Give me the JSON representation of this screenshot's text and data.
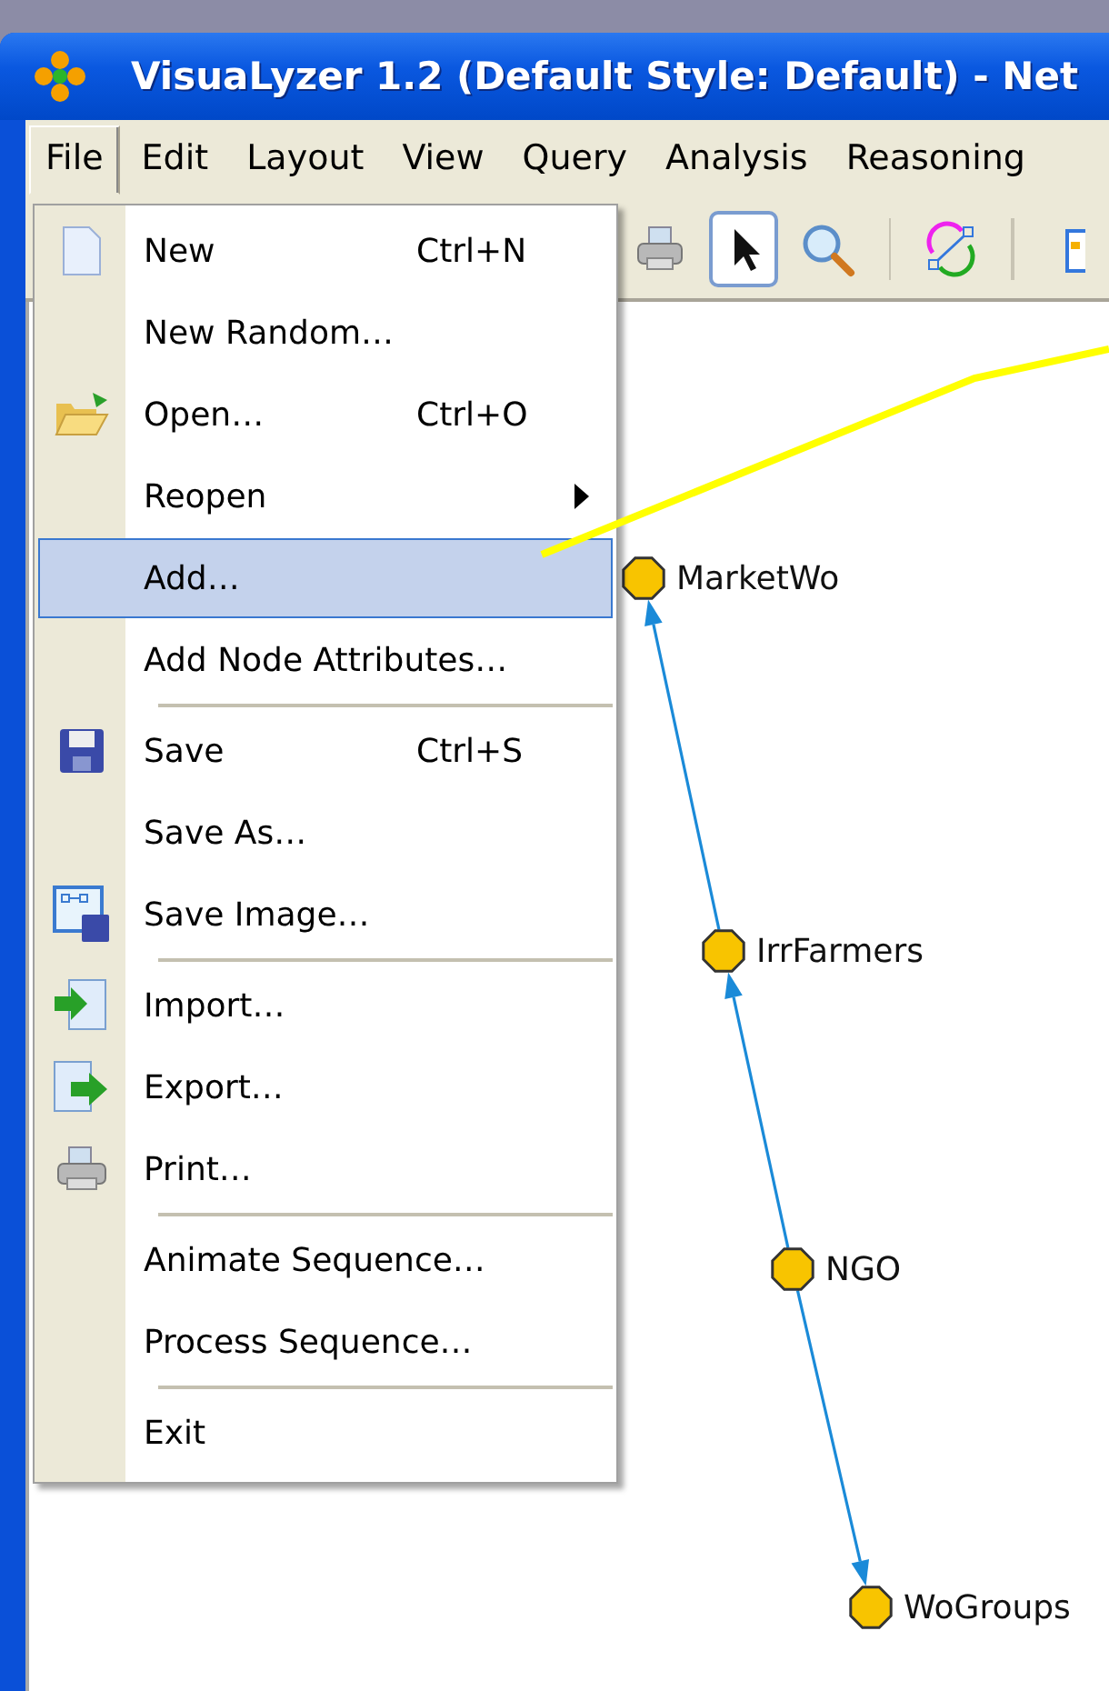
{
  "window": {
    "title": "VisuaLyzer 1.2 (Default Style: Default) - Net"
  },
  "menu_bar": [
    {
      "label": "File",
      "selected": true
    },
    {
      "label": "Edit",
      "selected": false
    },
    {
      "label": "Layout",
      "selected": false
    },
    {
      "label": "View",
      "selected": false
    },
    {
      "label": "Query",
      "selected": false
    },
    {
      "label": "Analysis",
      "selected": false
    },
    {
      "label": "Reasoning",
      "selected": false
    }
  ],
  "toolbar": [
    {
      "kind": "printer",
      "selected": false
    },
    {
      "kind": "pointer",
      "selected": true
    },
    {
      "kind": "zoom",
      "selected": false
    },
    {
      "kind": "separator"
    },
    {
      "kind": "cycle",
      "selected": false
    },
    {
      "kind": "separator"
    },
    {
      "kind": "layout",
      "selected": false
    }
  ],
  "file_menu": [
    {
      "kind": "item",
      "label": "New",
      "shortcut": "Ctrl+N",
      "submenu": false,
      "selected": false
    },
    {
      "kind": "item",
      "label": "New Random…",
      "submenu": false,
      "selected": false
    },
    {
      "kind": "item",
      "label": "Open…",
      "shortcut": "Ctrl+O",
      "submenu": false,
      "selected": false
    },
    {
      "kind": "item",
      "label": "Reopen",
      "submenu": true,
      "selected": false
    },
    {
      "kind": "item",
      "label": "Add…",
      "submenu": false,
      "selected": true
    },
    {
      "kind": "item",
      "label": "Add Node Attributes…",
      "submenu": false,
      "selected": false
    },
    {
      "kind": "separator"
    },
    {
      "kind": "item",
      "label": "Save",
      "shortcut": "Ctrl+S",
      "submenu": false,
      "selected": false
    },
    {
      "kind": "item",
      "label": "Save As…",
      "submenu": false,
      "selected": false
    },
    {
      "kind": "item",
      "label": "Save Image…",
      "submenu": false,
      "selected": false
    },
    {
      "kind": "separator"
    },
    {
      "kind": "item",
      "label": "Import…",
      "submenu": false,
      "selected": false
    },
    {
      "kind": "item",
      "label": "Export…",
      "submenu": false,
      "selected": false
    },
    {
      "kind": "item",
      "label": "Print…",
      "submenu": false,
      "selected": false
    },
    {
      "kind": "separator"
    },
    {
      "kind": "item",
      "label": "Animate Sequence…",
      "submenu": false,
      "selected": false
    },
    {
      "kind": "item",
      "label": "Process Sequence…",
      "submenu": false,
      "selected": false
    },
    {
      "kind": "separator"
    },
    {
      "kind": "item",
      "label": "Exit",
      "submenu": false,
      "selected": false
    }
  ],
  "network": {
    "nodes": [
      {
        "label": "MarketWo"
      },
      {
        "label": "IrrFarmers"
      },
      {
        "label": "NGO"
      },
      {
        "label": "WoGroups"
      }
    ]
  }
}
